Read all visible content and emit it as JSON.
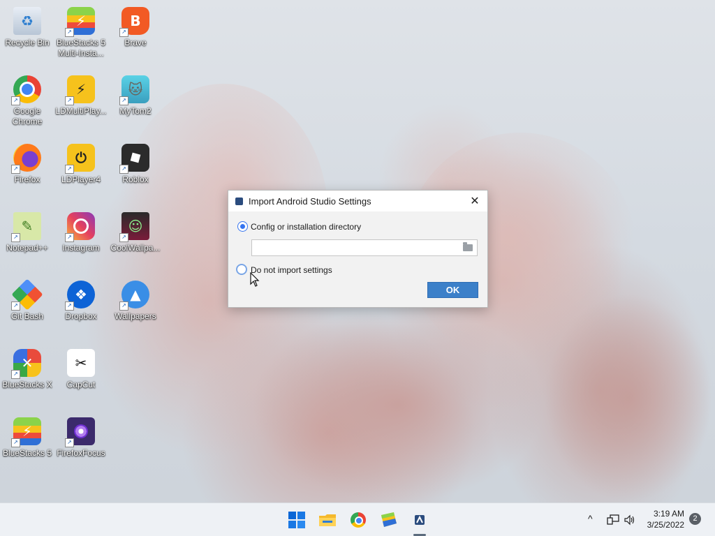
{
  "desktop": {
    "icons": [
      {
        "label": "Recycle Bin"
      },
      {
        "label": "BlueStacks 5 Multi-Insta..."
      },
      {
        "label": "Brave"
      },
      {
        "label": "Google Chrome"
      },
      {
        "label": "LDMultiPlay..."
      },
      {
        "label": "MyTom2"
      },
      {
        "label": "Firefox"
      },
      {
        "label": "LDPlayer4"
      },
      {
        "label": "Roblox"
      },
      {
        "label": "Notepad++"
      },
      {
        "label": "Instagram"
      },
      {
        "label": "CoolWallpa..."
      },
      {
        "label": "Git Bash"
      },
      {
        "label": "Dropbox"
      },
      {
        "label": "Wallpapers"
      },
      {
        "label": "BlueStacks X"
      },
      {
        "label": "CapCut"
      },
      {
        "label": "BlueStacks 5"
      },
      {
        "label": "FirefoxFocus"
      }
    ]
  },
  "dialog": {
    "title": "Import Android Studio Settings",
    "close_label": "✕",
    "option_config": "Config or installation directory",
    "option_config_selected": true,
    "path_value": "",
    "option_no_import": "Do not import settings",
    "option_no_import_selected": false,
    "ok_label": "OK"
  },
  "taskbar": {
    "apps": [
      "start-icon",
      "file-explorer-icon",
      "chrome-icon",
      "bluestacks-icon",
      "android-studio-icon"
    ],
    "active_app": "android-studio-icon",
    "tray_chevron": "^",
    "time": "3:19 AM",
    "date": "3/25/2022",
    "notification_count": "2"
  },
  "colors": {
    "accent": "#3574f0",
    "ok_button": "#3c80c9",
    "taskbar_bg": "#eef1f5"
  }
}
